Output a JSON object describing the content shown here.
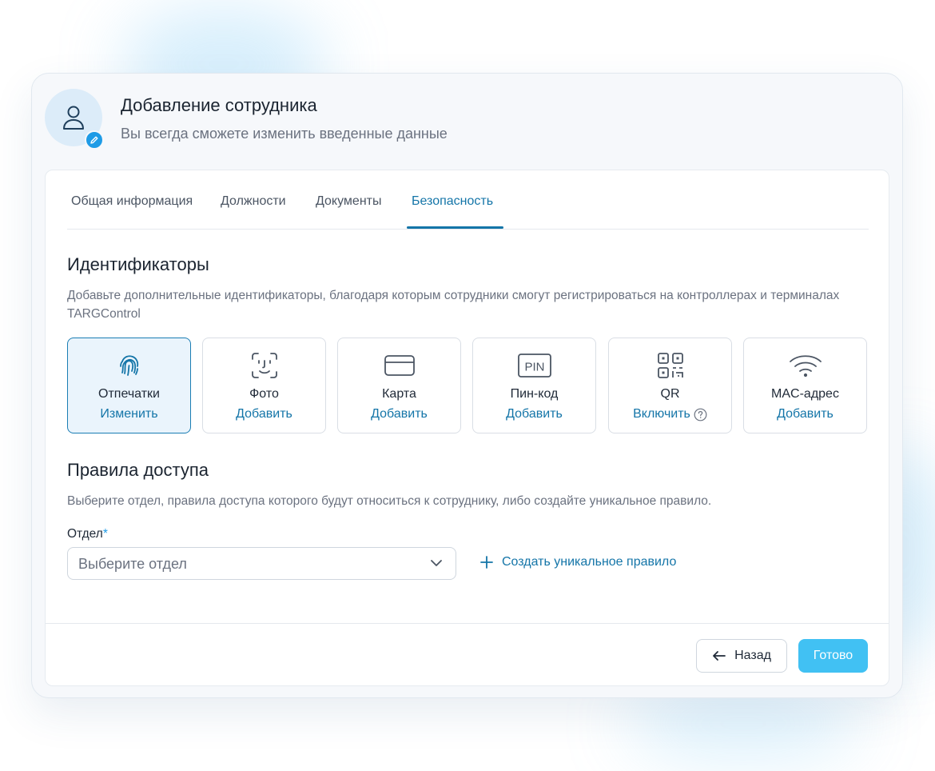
{
  "header": {
    "title": "Добавление сотрудника",
    "subtitle": "Вы всегда сможете изменить введенные данные"
  },
  "tabs": [
    {
      "label": "Общая информация",
      "active": false
    },
    {
      "label": "Должности",
      "active": false
    },
    {
      "label": "Документы",
      "active": false
    },
    {
      "label": "Безопасность",
      "active": true
    }
  ],
  "identifiers": {
    "title": "Идентификаторы",
    "description": "Добавьте дополнительные идентификаторы, благодаря которым сотрудники смогут регистрироваться на контроллерах и терминалах TARGControl",
    "items": [
      {
        "name": "Отпечатки",
        "action": "Изменить",
        "icon": "fingerprint-icon",
        "selected": true
      },
      {
        "name": "Фото",
        "action": "Добавить",
        "icon": "face-id-icon",
        "selected": false
      },
      {
        "name": "Карта",
        "action": "Добавить",
        "icon": "card-icon",
        "selected": false
      },
      {
        "name": "Пин-код",
        "action": "Добавить",
        "icon": "pin-icon",
        "icon_text": "PIN",
        "selected": false
      },
      {
        "name": "QR",
        "action": "Включить",
        "icon": "qr-code-icon",
        "selected": false,
        "has_help": true
      },
      {
        "name": "MAC-адрес",
        "action": "Добавить",
        "icon": "wifi-icon",
        "selected": false
      }
    ]
  },
  "access": {
    "title": "Правила доступа",
    "description": "Выберите отдел, правила доступа которого будут относиться к сотруднику, либо создайте уникальное правило.",
    "department_label": "Отдел",
    "required_mark": "*",
    "department_placeholder": "Выберите отдел",
    "create_rule_label": "Создать уникальное правило"
  },
  "footer": {
    "back_label": "Назад",
    "done_label": "Готово"
  },
  "colors": {
    "accent": "#1475a8",
    "primary_button": "#41c1f3",
    "selected_card_bg": "#eaf4fc",
    "edit_badge": "#1e9be6"
  }
}
